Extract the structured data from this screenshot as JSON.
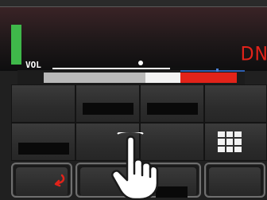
{
  "display": {
    "mode_text": "DN",
    "volume": {
      "label": "VOL",
      "level_fraction": 0.73
    },
    "meter_colors": {
      "grey": "#b9b9b9",
      "white": "#f2f2f2",
      "red": "#e2231a",
      "blue": "#2d5fb0"
    },
    "signal_color": "#3fb84a"
  },
  "keys": {
    "row1": [
      "",
      "",
      "",
      ""
    ],
    "row2": [
      "",
      "",
      "",
      "grid-icon"
    ]
  },
  "bottom_keys": [
    {
      "icon": "back-arrow-icon"
    },
    {
      "icon": ""
    },
    {
      "icon": ""
    },
    {
      "icon": ""
    }
  ],
  "overlay": {
    "icon": "tap-hand-icon"
  }
}
